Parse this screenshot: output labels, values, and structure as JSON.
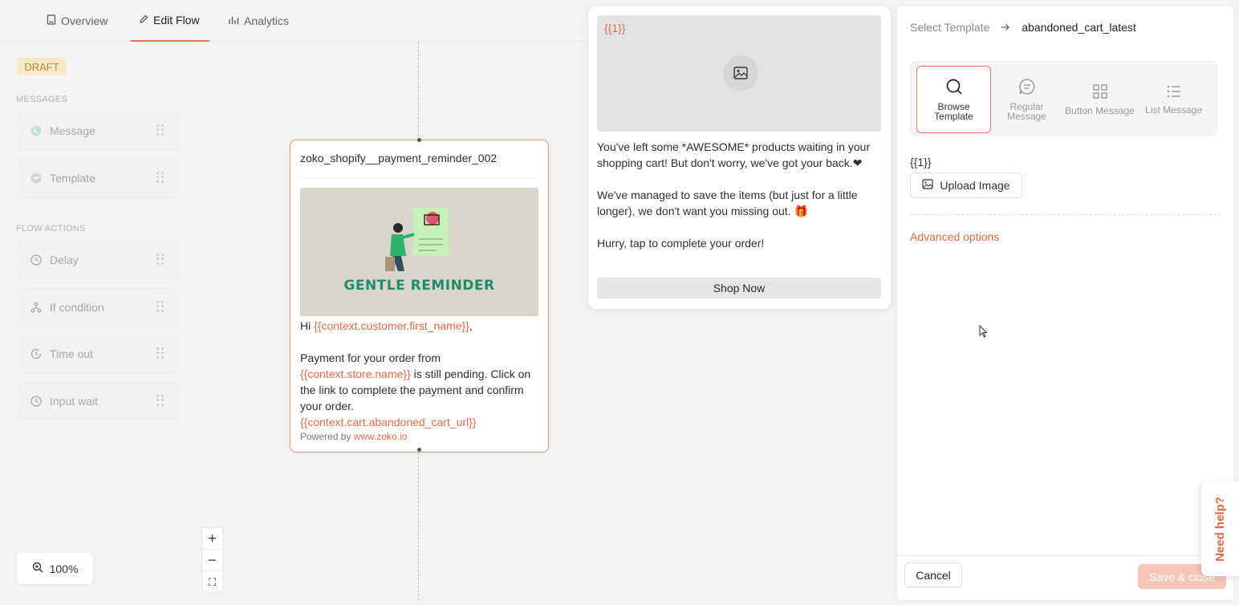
{
  "tabs": [
    {
      "label": "Overview",
      "icon": "document-icon"
    },
    {
      "label": "Edit Flow",
      "icon": "pencil-icon"
    },
    {
      "label": "Analytics",
      "icon": "bar-chart-icon"
    }
  ],
  "status_badge": "DRAFT",
  "palette": {
    "messages_label": "MESSAGES",
    "messages": [
      {
        "label": "Message",
        "icon": "whatsapp-icon"
      },
      {
        "label": "Template",
        "icon": "messenger-icon"
      }
    ],
    "actions_label": "FLOW ACTIONS",
    "actions": [
      {
        "label": "Delay",
        "icon": "clock-icon"
      },
      {
        "label": "If condition",
        "icon": "branch-icon"
      },
      {
        "label": "Time out",
        "icon": "timer-icon"
      },
      {
        "label": "Input wait",
        "icon": "clock-icon"
      }
    ]
  },
  "node": {
    "title": "zoko_shopify__payment_reminder_002",
    "image_caption": "GENTLE REMINDER",
    "greeting": "Hi ",
    "var_first_name": "{{context.customer.first_name}}",
    "greeting_end": ",",
    "line1": "Payment for your order from ",
    "var_store": "{{context.store.name}}",
    "line2": " is still pending. Click on the link to complete the payment and confirm your order.",
    "var_cart_url": "{{context.cart.abandoned_cart_url}}",
    "footer_prefix": "Powered by ",
    "footer_link": "www.zoko.io"
  },
  "zoom": {
    "level": "100%",
    "in": "+",
    "out": "−",
    "fit": "⛶"
  },
  "preview": {
    "media_placeholder": "{{1}}",
    "para1": "You've left some *AWESOME* products waiting in your shopping cart! But don't worry, we've got your back.❤",
    "para2": "We've managed to save the items (but just for a little longer), we don't want you missing out. 🎁",
    "para3": "Hurry, tap to complete your order!",
    "button": "Shop Now"
  },
  "panel": {
    "crumb_root": "Select Template",
    "crumb_current": "abandoned_cart_latest",
    "types": [
      {
        "label": "Browse Template",
        "icon": "search-icon",
        "active": true
      },
      {
        "label": "Regular Message",
        "icon": "chat-icon",
        "active": false
      },
      {
        "label": "Button Message",
        "icon": "grid-icon",
        "active": false
      },
      {
        "label": "List Message",
        "icon": "list-icon",
        "active": false
      }
    ],
    "variable_label": "{{1}}",
    "upload_label": "Upload Image",
    "advanced_label": "Advanced options",
    "cancel_label": "Cancel",
    "save_label": "Save & close"
  },
  "help_label": "Need help?"
}
